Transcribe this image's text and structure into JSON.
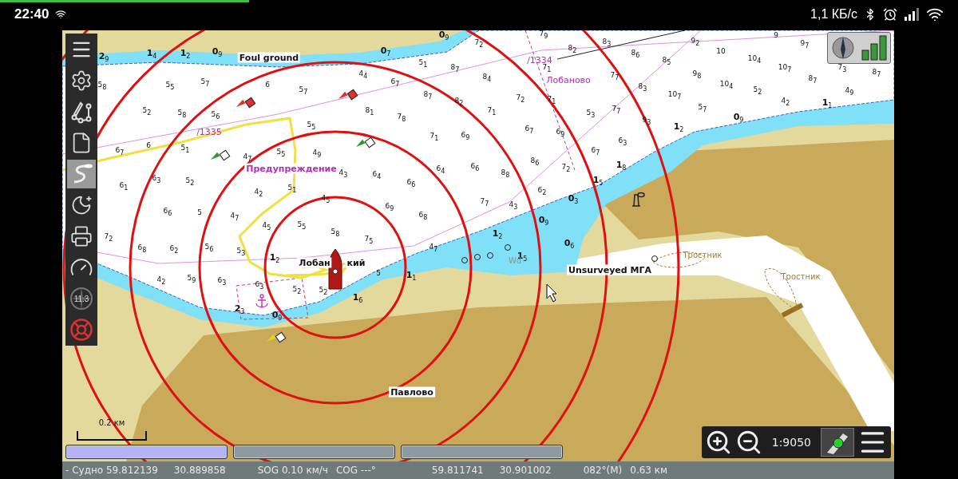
{
  "status_bar": {
    "time": "22:40",
    "net_speed": "1,1 КБ/с",
    "loading": {
      "level": 0.26
    }
  },
  "toolbar": {
    "items": [
      {
        "kind": "menu",
        "selected": false
      },
      {
        "kind": "settings",
        "selected": false
      },
      {
        "kind": "route",
        "selected": false
      },
      {
        "kind": "file",
        "selected": false
      },
      {
        "kind": "track",
        "selected": true
      },
      {
        "kind": "night",
        "selected": false
      },
      {
        "kind": "print",
        "selected": false
      },
      {
        "kind": "gauge",
        "selected": false
      },
      {
        "kind": "compass",
        "selected": false,
        "label": "11.3"
      },
      {
        "kind": "lifebuoy",
        "selected": false
      }
    ]
  },
  "map": {
    "labels": [
      {
        "kind": "name",
        "text": "Foul ground"
      },
      {
        "kind": "magenta",
        "text": "/1335"
      },
      {
        "kind": "warning",
        "text": "Предупреждение"
      },
      {
        "kind": "magenta",
        "text": "/1334"
      },
      {
        "kind": "magenta",
        "text": "Лобаново"
      },
      {
        "kind": "name",
        "text": "Лобан"
      },
      {
        "kind": "name",
        "text": "кий"
      },
      {
        "kind": "name",
        "text": "Unsurveyed МГА"
      },
      {
        "kind": "reed",
        "text": "Тростник"
      },
      {
        "kind": "reed",
        "text": "Тростник"
      },
      {
        "kind": "name",
        "text": "Павлово"
      },
      {
        "kind": "grey",
        "text": "Wd"
      }
    ],
    "soundings": [
      {
        "depth": "2$_{9}$",
        "bold": true
      },
      {
        "depth": "1$_{4}$",
        "bold": true
      },
      {
        "depth": "1$_{2}$",
        "bold": true
      },
      {
        "depth": "0$_{9}$",
        "bold": true
      },
      {
        "depth": "0$_{7}$",
        "bold": true
      },
      {
        "depth": "0$_{9}$",
        "bold": true
      },
      {
        "depth": "5$_{8}$",
        "bold": false
      },
      {
        "depth": "5$_{5}$",
        "bold": false
      },
      {
        "depth": "5$_{7}$",
        "bold": false
      },
      {
        "depth": "6",
        "bold": false
      },
      {
        "depth": "5$_{7}$",
        "bold": false
      },
      {
        "depth": "4$_{4}$",
        "bold": false
      },
      {
        "depth": "5$_{2}$",
        "bold": false
      },
      {
        "depth": "5$_{8}$",
        "bold": false
      },
      {
        "depth": "5$_{6}$",
        "bold": false
      },
      {
        "depth": "8$_{1}$",
        "bold": false
      },
      {
        "depth": "5$_{5}$",
        "bold": false
      },
      {
        "depth": "6$_{7}$",
        "bold": false
      },
      {
        "depth": "6",
        "bold": false
      },
      {
        "depth": "5$_{1}$",
        "bold": false
      },
      {
        "depth": "4$_{7}$",
        "bold": false
      },
      {
        "depth": "5$_{5}$",
        "bold": false
      },
      {
        "depth": "4$_{9}$",
        "bold": false
      },
      {
        "depth": "4$_{3}$",
        "bold": false
      },
      {
        "depth": "6$_{4}$",
        "bold": false
      },
      {
        "depth": "6$_{1}$",
        "bold": false
      },
      {
        "depth": "6$_{3}$",
        "bold": false
      },
      {
        "depth": "5$_{2}$",
        "bold": false
      },
      {
        "depth": "4$_{2}$",
        "bold": false
      },
      {
        "depth": "5$_{1}$",
        "bold": false
      },
      {
        "depth": "6$_{6}$",
        "bold": false
      },
      {
        "depth": "5",
        "bold": false
      },
      {
        "depth": "4$_{7}$",
        "bold": false
      },
      {
        "depth": "4$_{5}$",
        "bold": false
      },
      {
        "depth": "5$_{5}$",
        "bold": false
      },
      {
        "depth": "4$_{5}$",
        "bold": false
      },
      {
        "depth": "7$_{2}$",
        "bold": false
      },
      {
        "depth": "6$_{8}$",
        "bold": false
      },
      {
        "depth": "6$_{2}$",
        "bold": false
      },
      {
        "depth": "5$_{6}$",
        "bold": false
      },
      {
        "depth": "5$_{3}$",
        "bold": false
      },
      {
        "depth": "1$_{2}$",
        "bold": true
      },
      {
        "depth": "5$_{8}$",
        "bold": false
      },
      {
        "depth": "7$_{5}$",
        "bold": false
      },
      {
        "depth": "4$_{2}$",
        "bold": false
      },
      {
        "depth": "5$_{9}$",
        "bold": false
      },
      {
        "depth": "6$_{3}$",
        "bold": false
      },
      {
        "depth": "6$_{3}$",
        "bold": false
      },
      {
        "depth": "5$_{2}$",
        "bold": false
      },
      {
        "depth": "5$_{2}$",
        "bold": false
      },
      {
        "depth": "5",
        "bold": false
      },
      {
        "depth": "1$_{1}$",
        "bold": true
      },
      {
        "depth": "1$_{6}$",
        "bold": true
      },
      {
        "depth": "2$_{3}$",
        "bold": true
      },
      {
        "depth": "0$_{9}$",
        "bold": true
      },
      {
        "depth": "7$_{9}$",
        "bold": false
      },
      {
        "depth": "7$_{2}$",
        "bold": false
      },
      {
        "depth": "8$_{3}$",
        "bold": false
      },
      {
        "depth": "8$_{2}$",
        "bold": false
      },
      {
        "depth": "9$_{2}$",
        "bold": false
      },
      {
        "depth": "9",
        "bold": false
      },
      {
        "depth": "9$_{7}$",
        "bold": false
      },
      {
        "depth": "5$_{1}$",
        "bold": false
      },
      {
        "depth": "8$_{7}$",
        "bold": false
      },
      {
        "depth": "7$_{1}$",
        "bold": false
      },
      {
        "depth": "8$_{6}$",
        "bold": false
      },
      {
        "depth": "8$_{5}$",
        "bold": false
      },
      {
        "depth": "10",
        "bold": false
      },
      {
        "depth": "10$_{4}$",
        "bold": false
      },
      {
        "depth": "10$_{7}$",
        "bold": false
      },
      {
        "depth": "7$_{3}$",
        "bold": false
      },
      {
        "depth": "8$_{7}$",
        "bold": false
      },
      {
        "depth": "6$_{7}$",
        "bold": false
      },
      {
        "depth": "8$_{4}$",
        "bold": false
      },
      {
        "depth": "7$_{7}$",
        "bold": false
      },
      {
        "depth": "9$_{8}$",
        "bold": false
      },
      {
        "depth": "8$_{7}$",
        "bold": false
      },
      {
        "depth": "10$_{4}$",
        "bold": false
      },
      {
        "depth": "5$_{2}$",
        "bold": false
      },
      {
        "depth": "4$_{2}$",
        "bold": false
      },
      {
        "depth": "4$_{9}$",
        "bold": false
      },
      {
        "depth": "8$_{7}$",
        "bold": false
      },
      {
        "depth": "8$_{2}$",
        "bold": false
      },
      {
        "depth": "7$_{2}$",
        "bold": false
      },
      {
        "depth": "7$_{1}$",
        "bold": false
      },
      {
        "depth": "8$_{3}$",
        "bold": false
      },
      {
        "depth": "10$_{7}$",
        "bold": false
      },
      {
        "depth": "5$_{7}$",
        "bold": false
      },
      {
        "depth": "7$_{8}$",
        "bold": false
      },
      {
        "depth": "7$_{1}$",
        "bold": false
      },
      {
        "depth": "5$_{3}$",
        "bold": false
      },
      {
        "depth": "7$_{7}$",
        "bold": false
      },
      {
        "depth": "9$_{3}$",
        "bold": false
      },
      {
        "depth": "7$_{1}$",
        "bold": false
      },
      {
        "depth": "6$_{9}$",
        "bold": false
      },
      {
        "depth": "6$_{7}$",
        "bold": false
      },
      {
        "depth": "6$_{9}$",
        "bold": false
      },
      {
        "depth": "6$_{3}$",
        "bold": false
      },
      {
        "depth": "6$_{7}$",
        "bold": false
      },
      {
        "depth": "6$_{4}$",
        "bold": false
      },
      {
        "depth": "6$_{6}$",
        "bold": false
      },
      {
        "depth": "8$_{6}$",
        "bold": false
      },
      {
        "depth": "8$_{8}$",
        "bold": false
      },
      {
        "depth": "7$_{2}$",
        "bold": false
      },
      {
        "depth": "6$_{2}$",
        "bold": false
      },
      {
        "depth": "6$_{6}$",
        "bold": false
      },
      {
        "depth": "7$_{7}$",
        "bold": false
      },
      {
        "depth": "4$_{3}$",
        "bold": false
      },
      {
        "depth": "6$_{9}$",
        "bold": false
      },
      {
        "depth": "6$_{8}$",
        "bold": false
      },
      {
        "depth": "4$_{7}$",
        "bold": false
      },
      {
        "depth": "1$_{2}$",
        "bold": true
      },
      {
        "depth": "0$_{9}$",
        "bold": true
      },
      {
        "depth": "1$_{1}$",
        "bold": true
      },
      {
        "depth": "1$_{8}$",
        "bold": true
      },
      {
        "depth": "1$_{5}$",
        "bold": true
      },
      {
        "depth": "0$_{3}$",
        "bold": true
      },
      {
        "depth": "0$_{9}$",
        "bold": true
      },
      {
        "depth": "1$_{2}$",
        "bold": true
      },
      {
        "depth": "0$_{6}$",
        "bold": true
      },
      {
        "depth": "1$_{5}$",
        "bold": true
      }
    ],
    "scale_label": "0.2 км",
    "panels": [
      {
        "selected": true
      },
      {
        "selected": false
      },
      {
        "selected": false
      }
    ],
    "zoom_scale": "1:9050"
  },
  "info_bar": [
    "- Судно 59.812139",
    "30.889858",
    "SOG 0.10 км/ч",
    "COG ---°",
    "59.811741",
    "30.901002",
    "082°(M)",
    "0.63 км"
  ]
}
